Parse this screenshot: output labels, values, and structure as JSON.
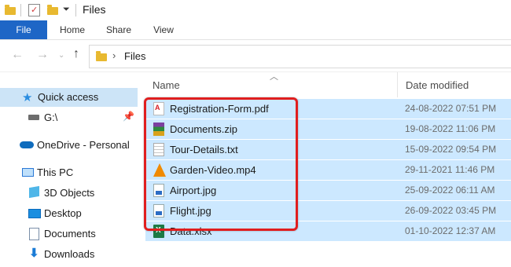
{
  "window": {
    "title": "Files"
  },
  "ribbon": {
    "tabs": [
      "File",
      "Home",
      "Share",
      "View"
    ]
  },
  "address": {
    "path": "Files"
  },
  "sidebar": {
    "items": [
      {
        "label": "Quick access",
        "icon": "star-icon"
      },
      {
        "label": "G:\\",
        "icon": "drive-icon"
      },
      {
        "label": "OneDrive - Personal",
        "icon": "cloud-icon"
      },
      {
        "label": "This PC",
        "icon": "computer-icon"
      },
      {
        "label": "3D Objects",
        "icon": "cube-icon"
      },
      {
        "label": "Desktop",
        "icon": "desktop-icon"
      },
      {
        "label": "Documents",
        "icon": "documents-icon"
      },
      {
        "label": "Downloads",
        "icon": "download-icon"
      }
    ]
  },
  "columns": {
    "name": "Name",
    "date": "Date modified"
  },
  "files": [
    {
      "name": "Registration-Form.pdf",
      "date": "24-08-2022 07:51 PM",
      "icon": "pdf-icon",
      "color": "#d81f26"
    },
    {
      "name": "Documents.zip",
      "date": "19-08-2022 11:06 PM",
      "icon": "zip-icon",
      "color": "#7b3fa0"
    },
    {
      "name": "Tour-Details.txt",
      "date": "15-09-2022 09:54 PM",
      "icon": "text-file-icon",
      "color": "#9a9a9a"
    },
    {
      "name": "Garden-Video.mp4",
      "date": "29-11-2021 11:46 PM",
      "icon": "vlc-icon",
      "color": "#f08a00"
    },
    {
      "name": "Airport.jpg",
      "date": "25-09-2022 06:11 AM",
      "icon": "image-file-icon",
      "color": "#2b6cc4"
    },
    {
      "name": "Flight.jpg",
      "date": "26-09-2022 03:45 PM",
      "icon": "image-file-icon",
      "color": "#2b6cc4"
    },
    {
      "name": "Data.xlsx",
      "date": "01-10-2022 12:37 AM",
      "icon": "excel-icon",
      "color": "#1d7a45"
    }
  ],
  "colors": {
    "accent": "#1e66c6",
    "selection": "#cce8ff",
    "highlight": "#e01e1e"
  }
}
